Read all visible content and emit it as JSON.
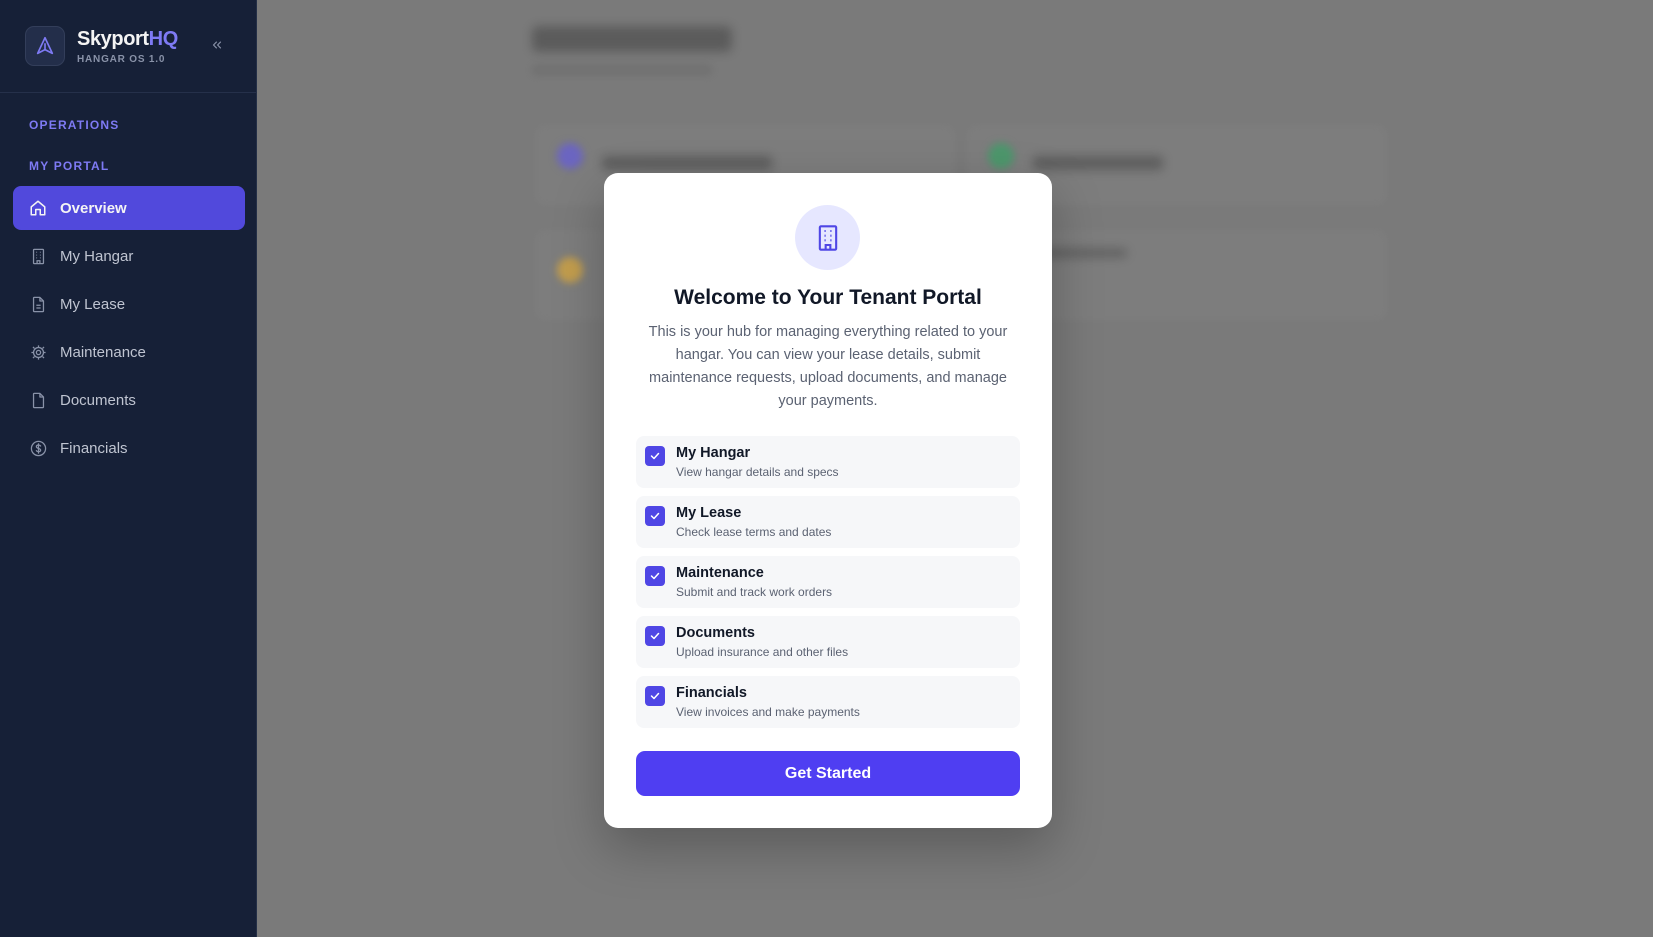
{
  "brand": {
    "name_main": "Skyport",
    "name_accent": "HQ",
    "subtitle": "HANGAR OS 1.0",
    "logo_icon": "navigation-arrow-icon",
    "collapse_icon": "chevrons-left-icon"
  },
  "sidebar": {
    "sections": [
      "OPERATIONS",
      "MY PORTAL"
    ],
    "items": [
      {
        "label": "Overview",
        "icon": "home-icon",
        "active": true
      },
      {
        "label": "My Hangar",
        "icon": "building-icon",
        "active": false
      },
      {
        "label": "My Lease",
        "icon": "file-text-icon",
        "active": false
      },
      {
        "label": "Maintenance",
        "icon": "gear-icon",
        "active": false
      },
      {
        "label": "Documents",
        "icon": "file-icon",
        "active": false
      },
      {
        "label": "Financials",
        "icon": "dollar-circle-icon",
        "active": false
      }
    ]
  },
  "modal": {
    "icon": "building-icon",
    "title": "Welcome to Your Tenant Portal",
    "description": "This is your hub for managing everything related to your hangar. You can view your lease details, submit maintenance requests, upload documents, and manage your payments.",
    "features": [
      {
        "title": "My Hangar",
        "subtitle": "View hangar details and specs",
        "checked": true
      },
      {
        "title": "My Lease",
        "subtitle": "Check lease terms and dates",
        "checked": true
      },
      {
        "title": "Maintenance",
        "subtitle": "Submit and track work orders",
        "checked": true
      },
      {
        "title": "Documents",
        "subtitle": "Upload insurance and other files",
        "checked": true
      },
      {
        "title": "Financials",
        "subtitle": "View invoices and make payments",
        "checked": true
      }
    ],
    "cta_label": "Get Started"
  },
  "colors": {
    "sidebar_bg": "#0f1a32",
    "accent": "#4f46e5",
    "brand_accent": "#7f7bff"
  }
}
